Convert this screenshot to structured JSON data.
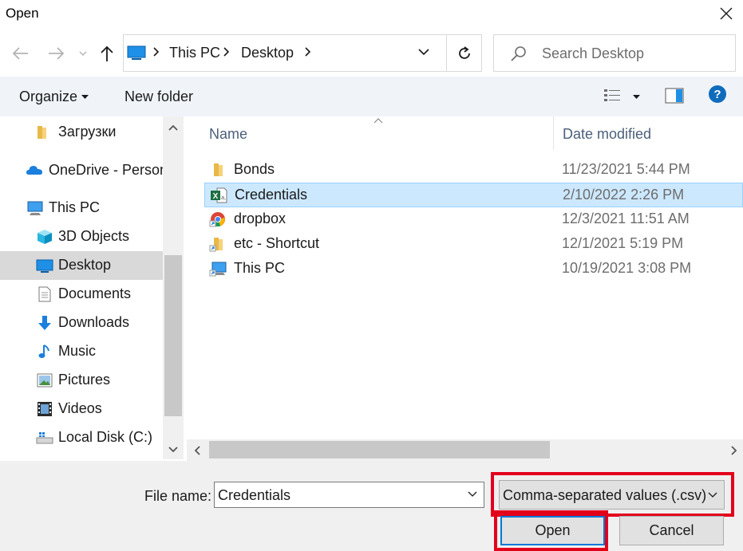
{
  "window": {
    "title": "Open"
  },
  "address": {
    "crumbs": [
      "This PC",
      "Desktop"
    ],
    "search_placeholder": "Search Desktop"
  },
  "toolbar": {
    "organize_label": "Organize",
    "new_folder_label": "New folder"
  },
  "nav_pane": {
    "items": [
      {
        "label": "Загрузки",
        "icon": "folder-icon"
      },
      {
        "label": "OneDrive - Person",
        "icon": "cloud-icon"
      },
      {
        "label": "This PC",
        "icon": "pc-icon"
      },
      {
        "label": "3D Objects",
        "icon": "cube-icon"
      },
      {
        "label": "Desktop",
        "icon": "desktop-icon",
        "selected": true
      },
      {
        "label": "Documents",
        "icon": "document-icon"
      },
      {
        "label": "Downloads",
        "icon": "download-icon"
      },
      {
        "label": "Music",
        "icon": "music-icon"
      },
      {
        "label": "Pictures",
        "icon": "pictures-icon"
      },
      {
        "label": "Videos",
        "icon": "videos-icon"
      },
      {
        "label": "Local Disk (C:)",
        "icon": "disk-icon"
      }
    ]
  },
  "file_list": {
    "columns": {
      "name": "Name",
      "date": "Date modified"
    },
    "rows": [
      {
        "name": "Bonds",
        "date": "11/23/2021 5:44 PM",
        "icon": "folder-icon"
      },
      {
        "name": "Credentials",
        "date": "2/10/2022 2:26 PM",
        "icon": "excel-file-icon",
        "selected": true
      },
      {
        "name": "dropbox",
        "date": "12/3/2021 11:51 AM",
        "icon": "chrome-shortcut-icon"
      },
      {
        "name": "etc - Shortcut",
        "date": "12/1/2021 5:19 PM",
        "icon": "folder-shortcut-icon"
      },
      {
        "name": "This PC",
        "date": "10/19/2021 3:08 PM",
        "icon": "pc-shortcut-icon"
      }
    ]
  },
  "footer": {
    "file_name_label": "File name:",
    "file_name_value": "Credentials",
    "file_type_value": "Comma-separated values  (.csv)",
    "open_label": "Open",
    "cancel_label": "Cancel"
  },
  "colors": {
    "accent": "#0078d7",
    "highlight": "#e3001b",
    "selection": "#cce8ff"
  }
}
